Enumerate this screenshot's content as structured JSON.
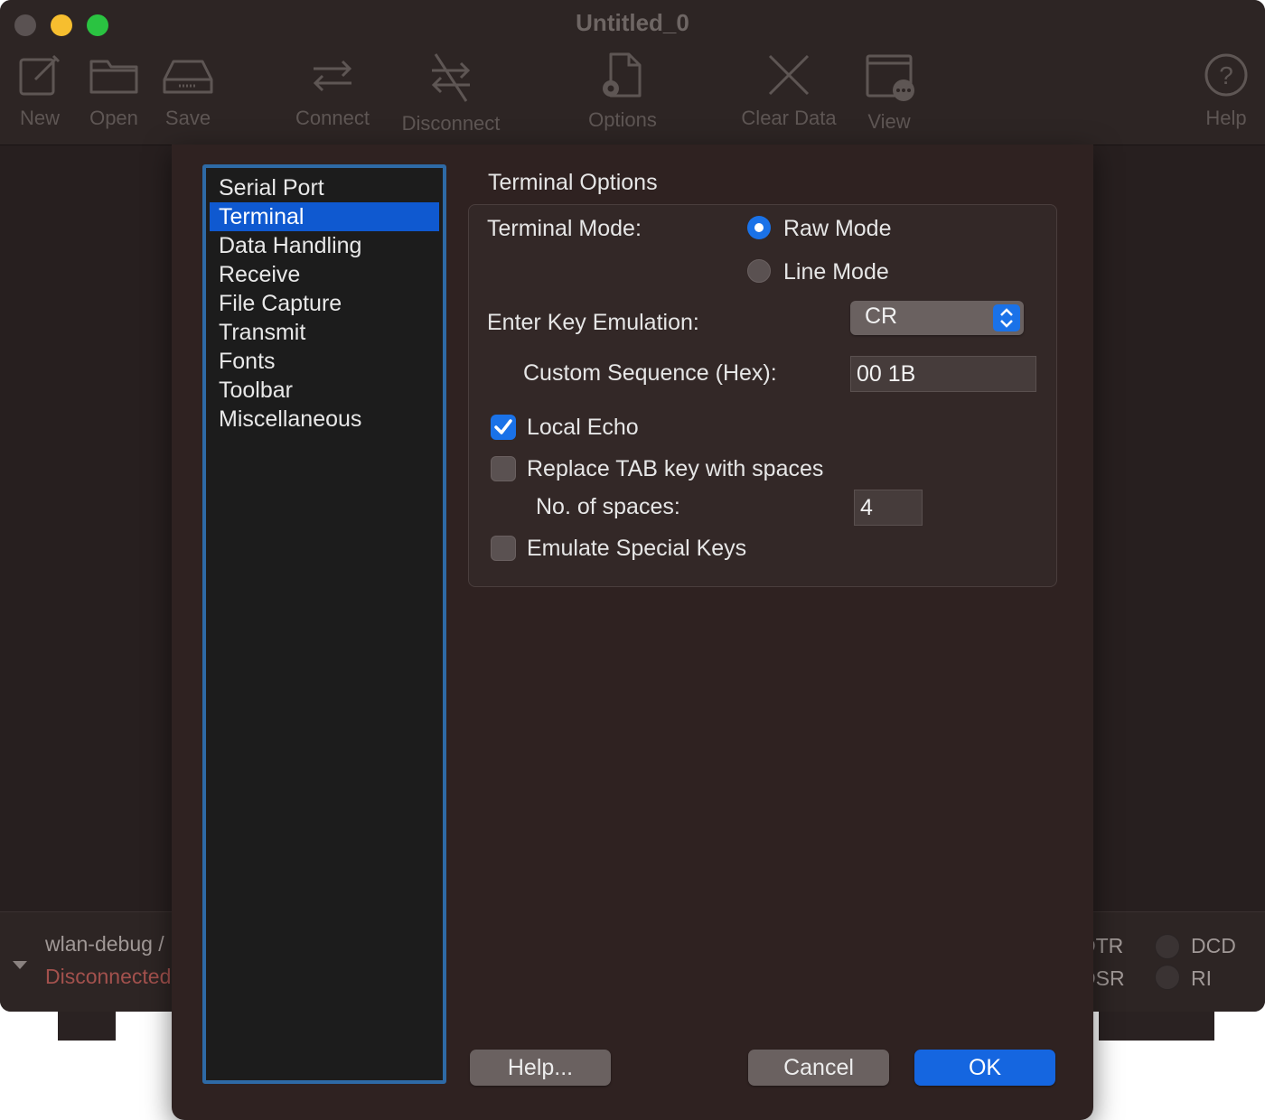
{
  "window": {
    "title": "Untitled_0"
  },
  "toolbar": {
    "items": [
      {
        "label": "New",
        "icon": "new-icon"
      },
      {
        "label": "Open",
        "icon": "folder-icon"
      },
      {
        "label": "Save",
        "icon": "save-icon"
      },
      {
        "label": "Connect",
        "icon": "connect-icon"
      },
      {
        "label": "Disconnect",
        "icon": "disconnect-icon"
      },
      {
        "label": "Options",
        "icon": "options-icon"
      },
      {
        "label": "Clear Data",
        "icon": "clear-icon"
      },
      {
        "label": "View",
        "icon": "view-icon"
      },
      {
        "label": "Help",
        "icon": "help-icon"
      }
    ]
  },
  "statusbar": {
    "port": "wlan-debug /",
    "status": "Disconnected",
    "signals": {
      "dtr": "DTR",
      "dcd": "DCD",
      "dsr": "DSR",
      "ri": "RI"
    }
  },
  "preferences": {
    "categories": [
      "Serial Port",
      "Terminal",
      "Data Handling",
      "Receive",
      "File Capture",
      "Transmit",
      "Fonts",
      "Toolbar",
      "Miscellaneous"
    ],
    "selected_category": "Terminal",
    "group_title": "Terminal Options",
    "terminal_mode_label": "Terminal Mode:",
    "mode_options": [
      "Raw Mode",
      "Line Mode"
    ],
    "selected_mode": "Raw Mode",
    "enter_key_label": "Enter Key Emulation:",
    "enter_key_value": "CR",
    "custom_sequence_label": "Custom Sequence (Hex):",
    "custom_sequence_value": "00 1B",
    "local_echo_label": "Local Echo",
    "local_echo_checked": true,
    "replace_tab_label": "Replace TAB key with spaces",
    "replace_tab_checked": false,
    "spaces_label": "No. of spaces:",
    "spaces_value": "4",
    "emulate_keys_label": "Emulate Special Keys",
    "emulate_keys_checked": false,
    "buttons": {
      "help": "Help...",
      "cancel": "Cancel",
      "ok": "OK"
    }
  },
  "colors": {
    "accent": "#1566e0",
    "selection": "#0f59d0",
    "disconnected": "#a3514d"
  }
}
